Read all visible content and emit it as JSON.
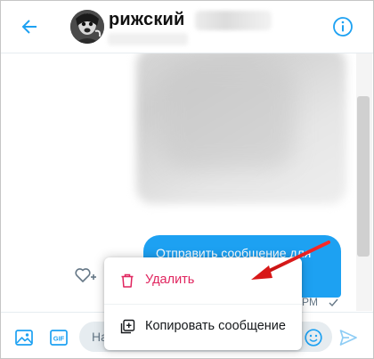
{
  "header": {
    "username": "рижский",
    "back_icon": "arrow-left-icon",
    "info_icon": "info-icon"
  },
  "message": {
    "text": "Отправить сообщение для",
    "time": "PM",
    "status_icon": "check-icon"
  },
  "context_menu": {
    "items": [
      {
        "label": "Удалить",
        "icon": "trash-icon",
        "color": "#e0245e"
      },
      {
        "label": "Копировать сообщение",
        "icon": "copy-add-icon",
        "color": "#14171a"
      }
    ]
  },
  "composer": {
    "placeholder_visible": "На",
    "icons": [
      "image-icon",
      "gif-icon",
      "emoji-icon",
      "send-icon"
    ]
  },
  "colors": {
    "accent": "#1da1f2",
    "danger": "#e0245e",
    "annotation_arrow": "#e02020"
  }
}
